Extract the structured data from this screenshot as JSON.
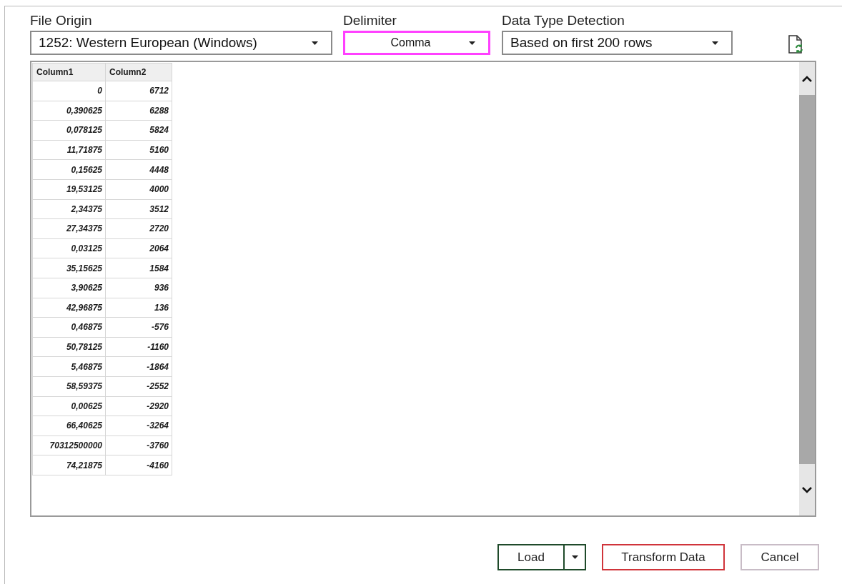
{
  "file_origin": {
    "label": "File Origin",
    "value": "1252: Western European (Windows)"
  },
  "delimiter": {
    "label": "Delimiter",
    "value": "Comma",
    "focused": true
  },
  "data_type_detection": {
    "label": "Data Type Detection",
    "value": "Based on first 200 rows"
  },
  "preview": {
    "columns": [
      "Column1",
      "Column2"
    ],
    "rows": [
      [
        "0",
        "6712"
      ],
      [
        "0,390625",
        "6288"
      ],
      [
        "0,078125",
        "5824"
      ],
      [
        "11,71875",
        "5160"
      ],
      [
        "0,15625",
        "4448"
      ],
      [
        "19,53125",
        "4000"
      ],
      [
        "2,34375",
        "3512"
      ],
      [
        "27,34375",
        "2720"
      ],
      [
        "0,03125",
        "2064"
      ],
      [
        "35,15625",
        "1584"
      ],
      [
        "3,90625",
        "936"
      ],
      [
        "42,96875",
        "136"
      ],
      [
        "0,46875",
        "-576"
      ],
      [
        "50,78125",
        "-1160"
      ],
      [
        "5,46875",
        "-1864"
      ],
      [
        "58,59375",
        "-2552"
      ],
      [
        "0,00625",
        "-2920"
      ],
      [
        "66,40625",
        "-3264"
      ],
      [
        "70312500000",
        "-3760"
      ],
      [
        "74,21875",
        "-4160"
      ]
    ]
  },
  "buttons": [
    {
      "label": "Load",
      "kind": "split",
      "color": "#1f4a2a"
    },
    {
      "label": "Transform Data",
      "kind": "plain",
      "color": "#d0343a"
    },
    {
      "label": "Cancel",
      "kind": "plain",
      "color": "#c8bcc6"
    }
  ]
}
